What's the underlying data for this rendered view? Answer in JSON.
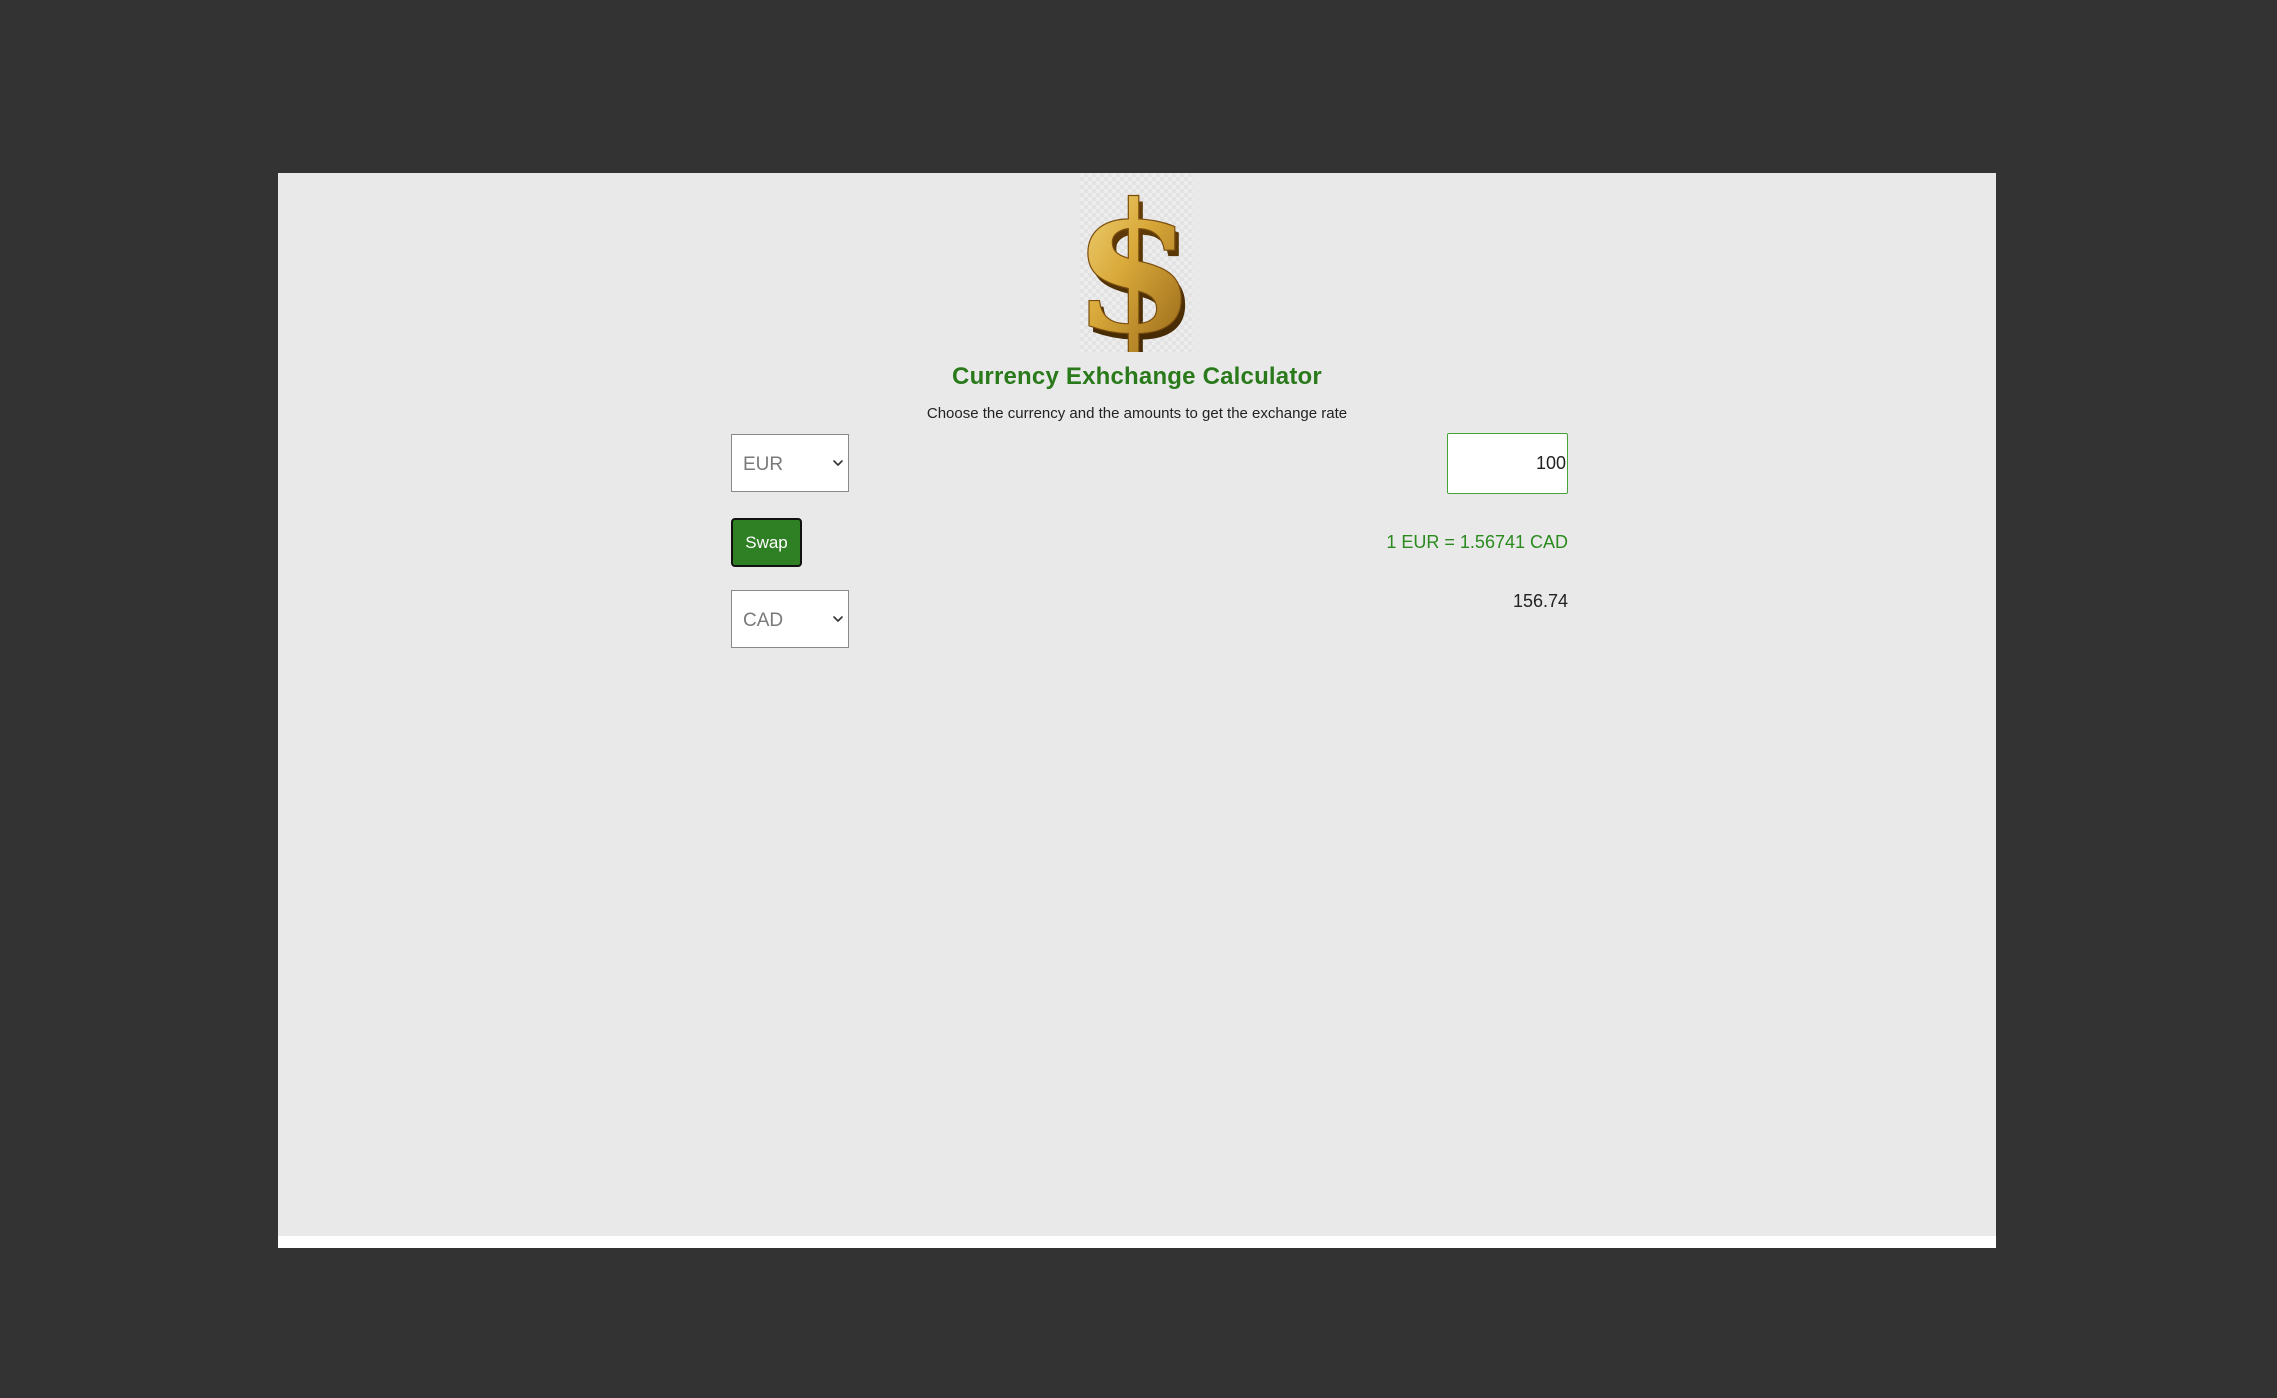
{
  "app": {
    "title": "Currency Exhchange Calculator",
    "subtitle": "Choose the currency and the amounts to get the exchange rate",
    "logo_icon": "dollar-sign-icon"
  },
  "from_currency": {
    "selected": "EUR",
    "icon": "chevron-down-icon"
  },
  "amount_input": {
    "value": "100"
  },
  "swap_button": {
    "label": "Swap"
  },
  "rate_text": "1 EUR = 1.56741 CAD",
  "to_currency": {
    "selected": "CAD",
    "icon": "chevron-down-icon"
  },
  "result": "156.74",
  "colors": {
    "accent": "#2f7f24",
    "title": "#2a7a1c",
    "rate": "#2a8a1e",
    "background": "#e9e9e9",
    "outer": "#333333"
  }
}
